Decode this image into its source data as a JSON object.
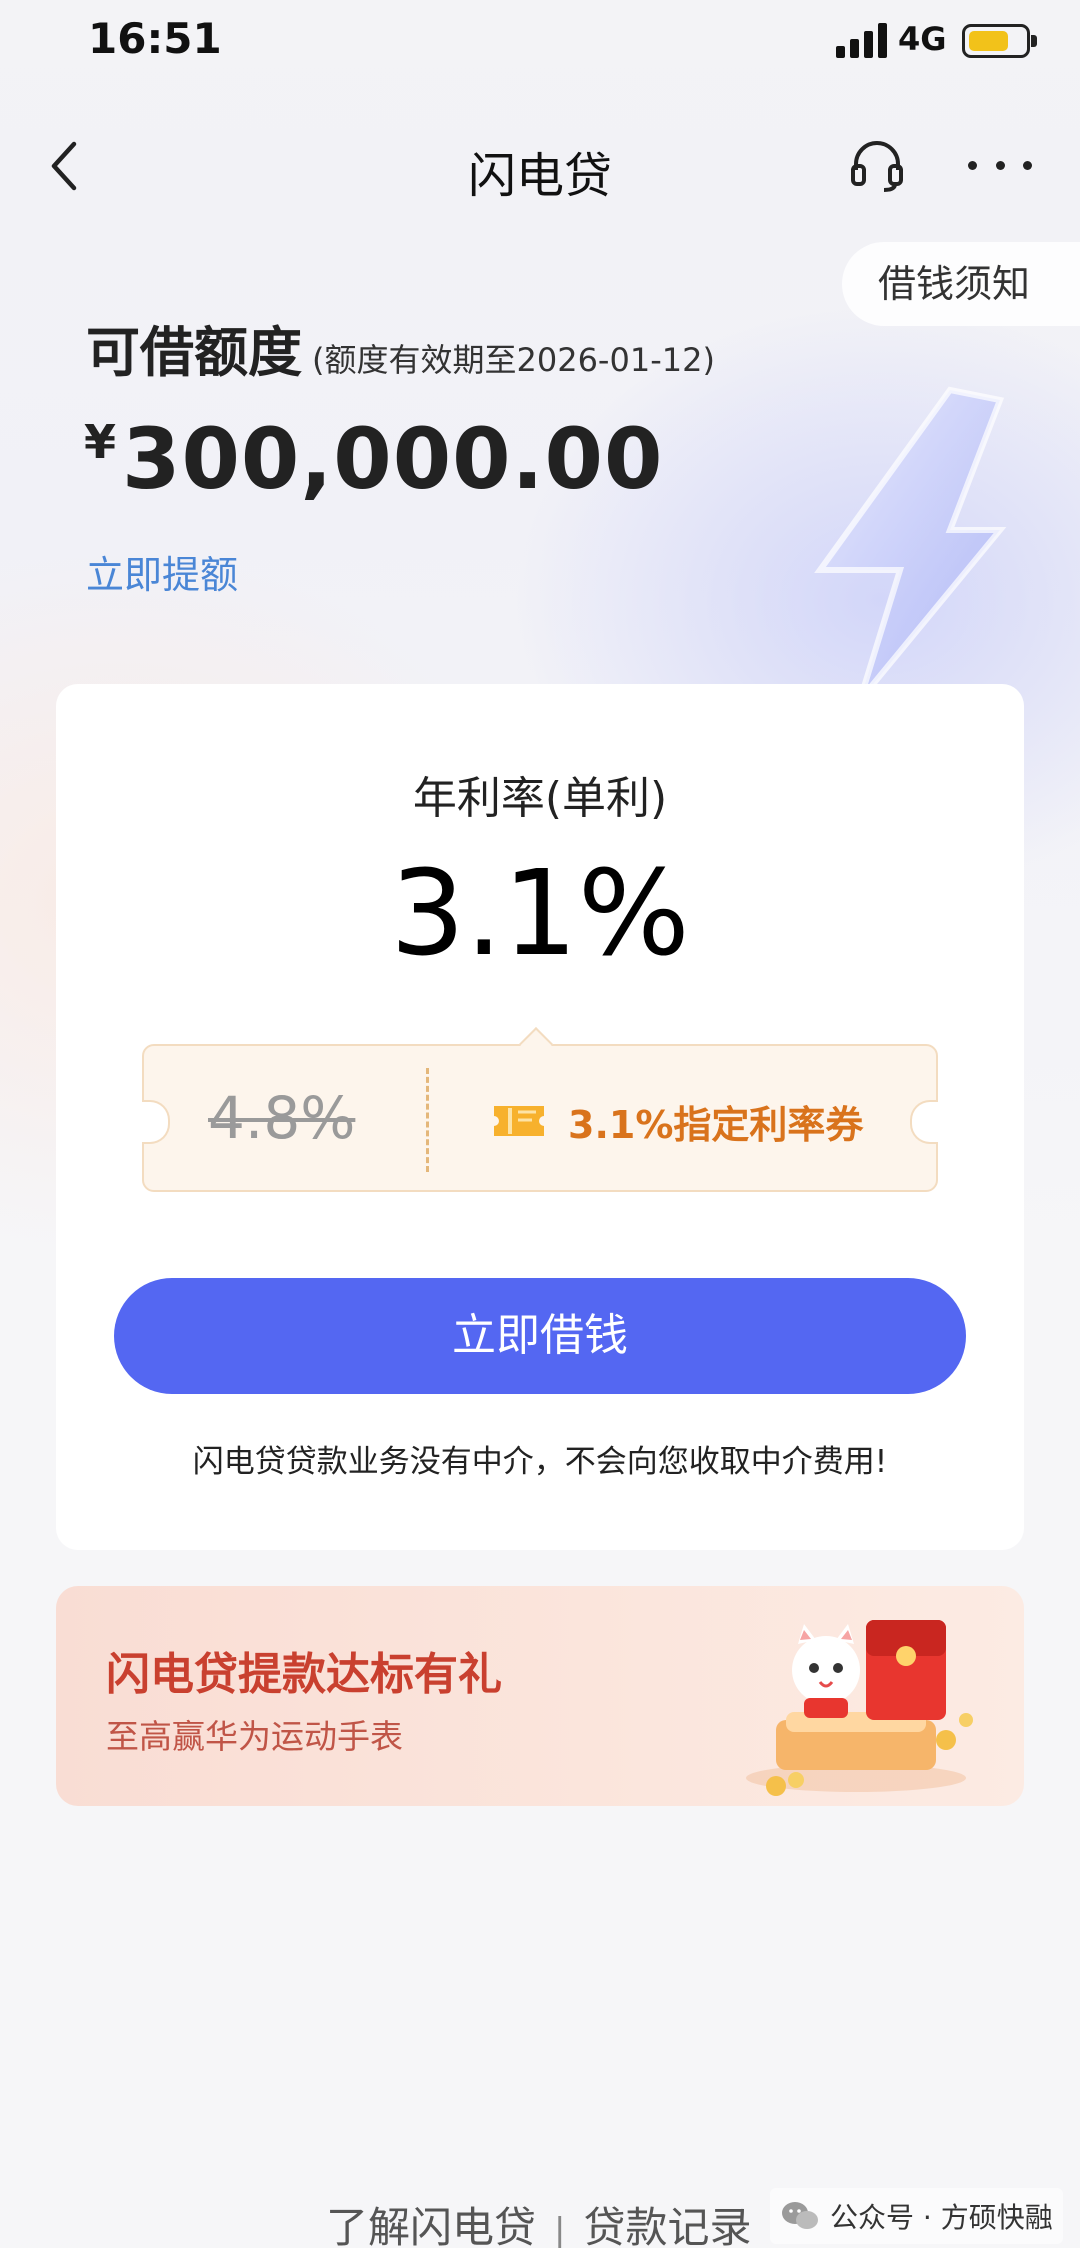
{
  "status_bar": {
    "time": "16:51",
    "network": "4G",
    "battery_level": 0.7,
    "battery_color": "#f2c21a"
  },
  "nav": {
    "title": "闪电贷",
    "back_icon": "chevron-left-icon",
    "service_icon": "headset-icon",
    "more_icon": "more-dots-icon"
  },
  "notice": {
    "label": "借钱须知"
  },
  "credit": {
    "title": "可借额度",
    "validity": "(额度有效期至2026-01-12)",
    "currency": "¥",
    "amount": "300,000.00",
    "withdraw_link": "立即提额"
  },
  "rate_card": {
    "label": "年利率(单利)",
    "rate": "3.1%",
    "original_rate": "4.8%",
    "coupon_text": "3.1%指定利率券",
    "coupon_icon": "ticket-icon",
    "borrow_button": "立即借钱",
    "disclaimer": "闪电贷贷款业务没有中介，不会向您收取中介费用!"
  },
  "promo": {
    "title": "闪电贷提款达标有礼",
    "subtitle": "至高赢华为运动手表"
  },
  "footer": {
    "link_about": "了解闪电贷",
    "separator": "|",
    "link_records": "贷款记录",
    "watermark": "公众号 · 方硕快融"
  },
  "colors": {
    "primary_button": "#5467f2",
    "link": "#4a86d6",
    "coupon_text": "#d9731c",
    "promo_title": "#c9402f"
  }
}
